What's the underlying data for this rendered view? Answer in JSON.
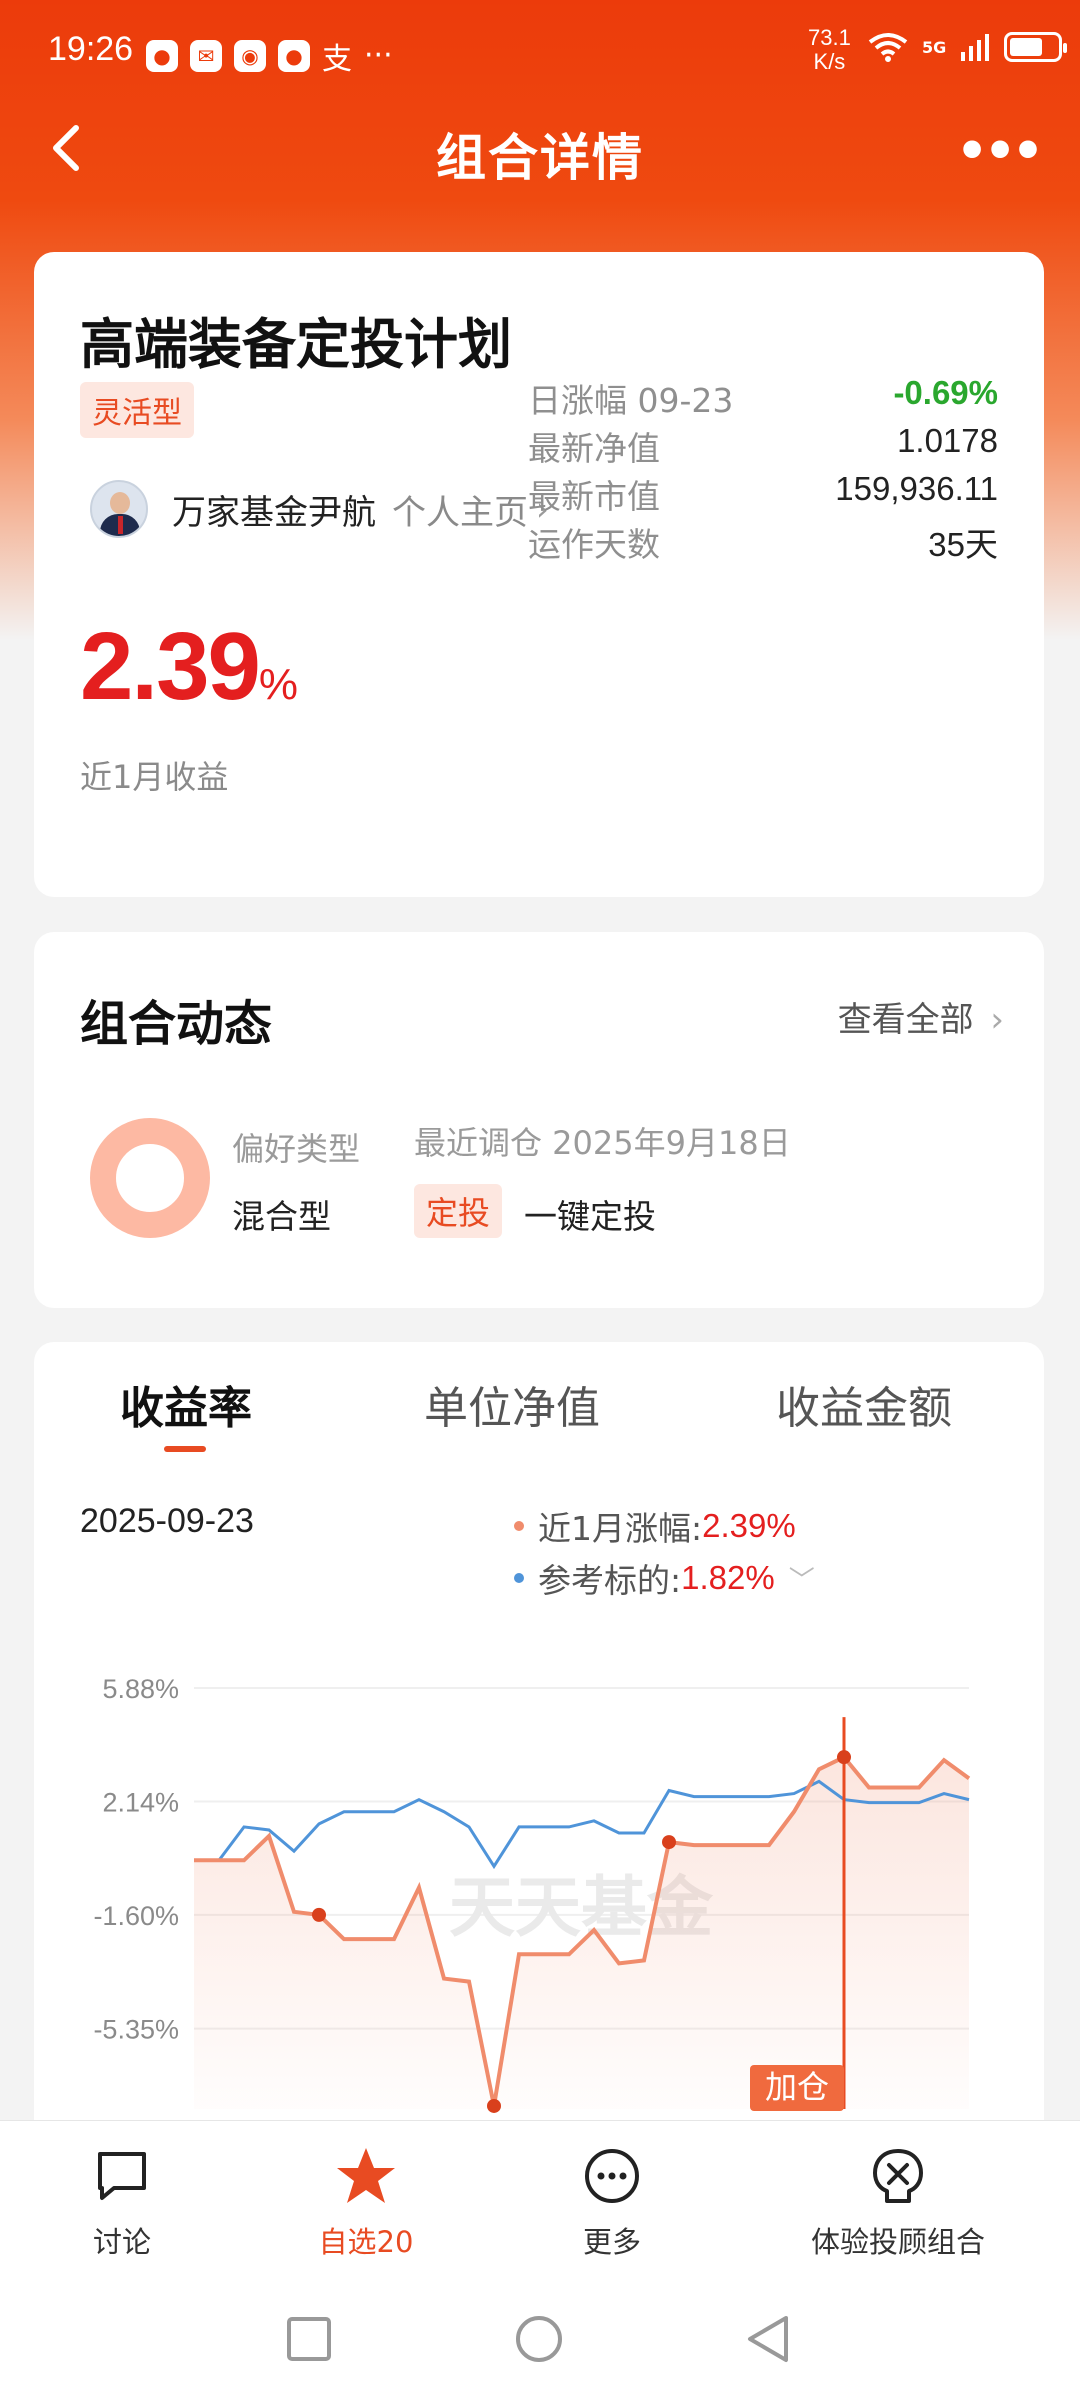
{
  "status_bar": {
    "time": "19:26",
    "net_speed_value": "73.1",
    "net_speed_unit": "K/s",
    "network": "5G",
    "battery_level_percent": 70
  },
  "nav": {
    "title": "组合详情",
    "back_icon": "back-arrow-icon",
    "more_icon": "more-dots-icon"
  },
  "portfolio": {
    "name": "高端装备定投计划",
    "type_tag": "灵活型",
    "manager_name": "万家基金尹航",
    "manager_link": "个人主页",
    "return_value": "2.39",
    "return_unit": "%",
    "return_label": "近1月收益",
    "stats": [
      {
        "label": "日涨幅 09-23",
        "value": "-0.69%"
      },
      {
        "label": "最新净值",
        "value": "1.0178"
      },
      {
        "label": "最新市值",
        "value": "159,936.11"
      },
      {
        "label": "运作天数",
        "value": "35天"
      }
    ]
  },
  "dynamics": {
    "title": "组合动态",
    "view_all": "查看全部",
    "preference_label": "偏好类型",
    "preference_value": "混合型",
    "rebalance_text": "最近调仓 2025年9月18日",
    "tag": "定投",
    "tag_text": "一键定投"
  },
  "chart_section": {
    "tabs": [
      "收益率",
      "单位净值",
      "收益金额"
    ],
    "active_tab": 0,
    "date": "2025-09-23",
    "legend": [
      {
        "label": "近1月涨幅:",
        "value": "2.39%",
        "color": "#f08c6c"
      },
      {
        "label": "参考标的:",
        "value": "1.82%",
        "color": "#4f94d9"
      }
    ],
    "watermark": "天天基金",
    "marker_label": "加仓"
  },
  "chart_data": {
    "type": "line",
    "ytick_labels": [
      "5.88%",
      "2.14%",
      "-1.60%",
      "-5.35%"
    ],
    "ytick_values": [
      5.88,
      2.14,
      -1.6,
      -5.35
    ],
    "ylim": [
      -8.0,
      5.88
    ],
    "series": [
      {
        "name": "近1月涨幅",
        "color": "#f08c6c",
        "values": [
          0.2,
          0.2,
          0.2,
          1.0,
          -1.5,
          -1.6,
          -2.4,
          -2.4,
          -2.4,
          -0.7,
          -3.7,
          -3.8,
          -7.9,
          -2.9,
          -2.9,
          -2.9,
          -2.1,
          -3.2,
          -3.1,
          0.8,
          0.7,
          0.7,
          0.7,
          0.7,
          1.8,
          3.2,
          3.6,
          2.6,
          2.6,
          2.6,
          3.5,
          2.9
        ]
      },
      {
        "name": "参考标的",
        "color": "#4f94d9",
        "values": [
          0.2,
          0.2,
          1.3,
          1.2,
          0.5,
          1.4,
          1.8,
          1.8,
          1.8,
          2.2,
          1.8,
          1.3,
          0.0,
          1.3,
          1.3,
          1.3,
          1.5,
          1.1,
          1.1,
          2.5,
          2.3,
          2.3,
          2.3,
          2.3,
          2.4,
          2.8,
          2.2,
          2.1,
          2.1,
          2.1,
          2.4,
          2.2
        ]
      }
    ],
    "markers": [
      5,
      12,
      19,
      26
    ],
    "highlight_index": 26
  },
  "bottom_bar": {
    "items": [
      {
        "label": "讨论",
        "icon": "chat-bubble-icon"
      },
      {
        "label": "自选20",
        "icon": "star-icon"
      },
      {
        "label": "更多",
        "icon": "more-circle-icon"
      },
      {
        "label": "体验投顾组合",
        "icon": "advisor-icon"
      }
    ]
  }
}
